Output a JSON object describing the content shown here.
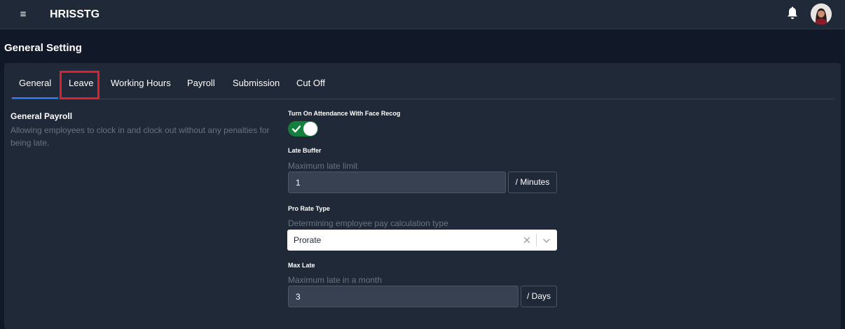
{
  "header": {
    "menu_icon": "hamburger-icon",
    "menu_glyph": "≡",
    "app_title": "HRISSTG",
    "notification_icon": "bell-icon",
    "avatar_icon": "user-avatar"
  },
  "page": {
    "title": "General Setting"
  },
  "tabs": [
    {
      "label": "General",
      "active": true
    },
    {
      "label": "Leave",
      "highlighted": true
    },
    {
      "label": "Working Hours"
    },
    {
      "label": "Payroll"
    },
    {
      "label": "Submission"
    },
    {
      "label": "Cut Off"
    }
  ],
  "section": {
    "title": "General Payroll",
    "description": "Allowing employees to clock in and clock out without any penalties for being late."
  },
  "fields": {
    "face_recog": {
      "label": "Turn On Attendance With Face Recog",
      "enabled": true
    },
    "late_buffer": {
      "label": "Late Buffer",
      "hint": "Maximum late limit",
      "value": "1",
      "unit": "/ Minutes"
    },
    "pro_rate": {
      "label": "Pro Rate Type",
      "hint": "Determining employee pay calculation type",
      "value": "Prorate"
    },
    "max_late": {
      "label": "Max Late",
      "hint": "Maximum late in a month",
      "value": "3",
      "unit": "/ Days"
    }
  },
  "colors": {
    "background": "#111827",
    "surface": "#1f2937",
    "accent": "#3b82f6",
    "toggle_on": "#15803d",
    "highlight": "#e11d2e"
  }
}
